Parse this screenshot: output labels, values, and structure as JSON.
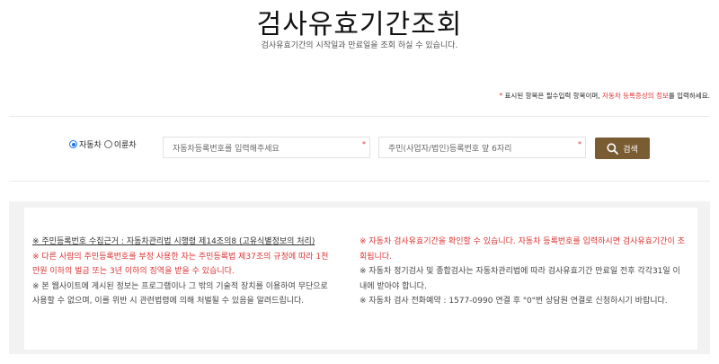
{
  "header": {
    "title": "검사유효기간조회",
    "subtitle": "검사유효기간의 시작일과 만료일을 조회 하실 수 있습니다."
  },
  "required_note": {
    "star": "*",
    "part1": " 표시된 항목은 필수입력 항목이며, ",
    "highlight": "자동차 등록증상의 정보",
    "part2": "를 입력하세요."
  },
  "form": {
    "radio_car": "자동차",
    "radio_bike": "이륜차",
    "car_number_placeholder": "자동차등록번호를 입력해주세요",
    "resident_placeholder": "주민(사업자/법인)등록번호 앞 6자리",
    "required_mark": "*",
    "search_label": "검색"
  },
  "notice": {
    "left": [
      "※ 주민등록번호 수집근거 : 자동차관리법 시행령 제14조의8 (고유식별정보의 처리)",
      "※ 다른 사람의 주민등록번호를 부정 사용한 자는 주민등록법 제37조의 규정에 따라 1천만원 이하의 벌금 또는 3년 이하의 징역을 받을 수 있습니다.",
      "※ 본 웹사이트에 게시된 정보는 프로그램이나 그 밖의 기술적 장치를 이용하여 무단으로 사용할 수 없으며, 이를 위반 시 관련법령에 의해 처벌될 수 있음을 알려드립니다."
    ],
    "right": [
      "※ 자동차 검사유효기간을 확인할 수 있습니다. 자동차 등록번호를 입력하시면 검사유효기간이 조회됩니다.",
      "※ 자동차 정기검사 및 종합검사는 자동차관리법에 따라 검사유효기간 만료일 전후 각각31일 이내에 받아야 합니다.",
      "※ 자동차 검사 전화예약 : 1577-0990 연결 후 \"0\"번 상담원 연결로 신청하시기 바랍니다."
    ]
  },
  "colors": {
    "accent_brown": "#7a5c33",
    "warning_red": "#d33333",
    "radio_blue": "#1a73e8"
  }
}
